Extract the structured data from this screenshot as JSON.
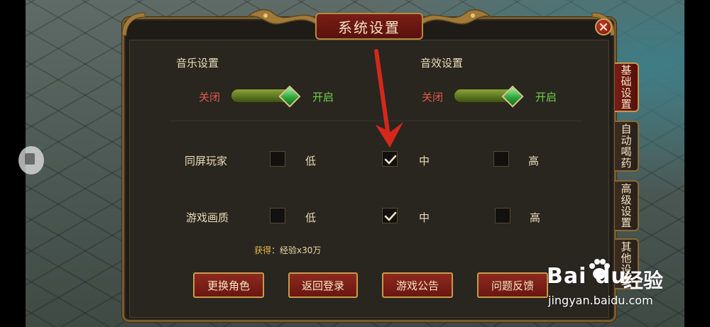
{
  "window": {
    "title": "系统设置"
  },
  "sound": {
    "music_label": "音乐设置",
    "effects_label": "音效设置",
    "off_label": "关闭",
    "on_label": "开启",
    "music_on": 1,
    "effects_on": 1
  },
  "display": {
    "rows": [
      {
        "label": "同屏玩家",
        "selected": "中"
      },
      {
        "label": "游戏画质",
        "selected": "中"
      }
    ],
    "options": [
      "低",
      "中",
      "高"
    ]
  },
  "reward": {
    "prefix": "获得",
    "text": "：经验x30万"
  },
  "buttons": {
    "change_role": "更换角色",
    "back_login": "返回登录",
    "announcement": "游戏公告",
    "feedback": "问题反馈"
  },
  "tabs": [
    {
      "label": "基础设置",
      "active": true
    },
    {
      "label": "自动喝药",
      "active": false
    },
    {
      "label": "高级设置",
      "active": false
    },
    {
      "label": "其他设置",
      "active": false
    }
  ],
  "watermark": {
    "brand": "Bai du",
    "product": "经验",
    "url": "jingyan.baidu.com"
  },
  "colors": {
    "accent_gold": "#c79a4a",
    "title_red": "#7a1d17",
    "off_red": "#e15a4a",
    "on_green": "#6fd34a",
    "arrow_red": "#d5281b"
  }
}
